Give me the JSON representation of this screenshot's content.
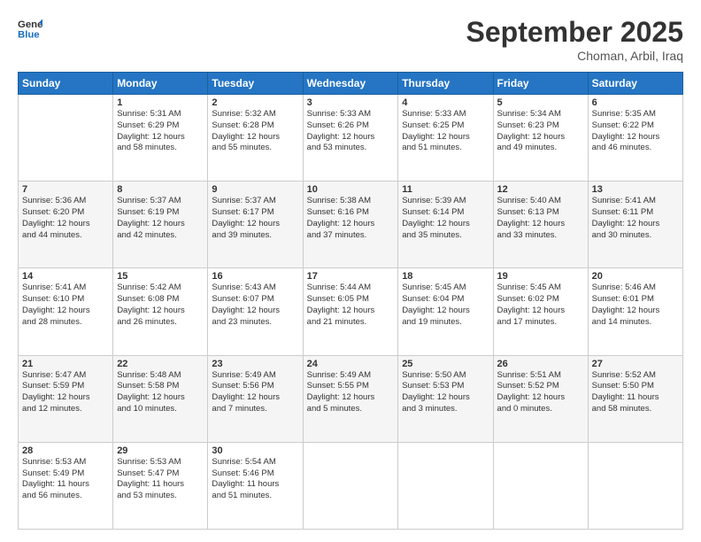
{
  "header": {
    "logo_text_general": "General",
    "logo_text_blue": "Blue",
    "month_title": "September 2025",
    "location": "Choman, Arbil, Iraq"
  },
  "weekdays": [
    "Sunday",
    "Monday",
    "Tuesday",
    "Wednesday",
    "Thursday",
    "Friday",
    "Saturday"
  ],
  "weeks": [
    [
      {
        "day": "",
        "info": ""
      },
      {
        "day": "1",
        "info": "Sunrise: 5:31 AM\nSunset: 6:29 PM\nDaylight: 12 hours\nand 58 minutes."
      },
      {
        "day": "2",
        "info": "Sunrise: 5:32 AM\nSunset: 6:28 PM\nDaylight: 12 hours\nand 55 minutes."
      },
      {
        "day": "3",
        "info": "Sunrise: 5:33 AM\nSunset: 6:26 PM\nDaylight: 12 hours\nand 53 minutes."
      },
      {
        "day": "4",
        "info": "Sunrise: 5:33 AM\nSunset: 6:25 PM\nDaylight: 12 hours\nand 51 minutes."
      },
      {
        "day": "5",
        "info": "Sunrise: 5:34 AM\nSunset: 6:23 PM\nDaylight: 12 hours\nand 49 minutes."
      },
      {
        "day": "6",
        "info": "Sunrise: 5:35 AM\nSunset: 6:22 PM\nDaylight: 12 hours\nand 46 minutes."
      }
    ],
    [
      {
        "day": "7",
        "info": "Sunrise: 5:36 AM\nSunset: 6:20 PM\nDaylight: 12 hours\nand 44 minutes."
      },
      {
        "day": "8",
        "info": "Sunrise: 5:37 AM\nSunset: 6:19 PM\nDaylight: 12 hours\nand 42 minutes."
      },
      {
        "day": "9",
        "info": "Sunrise: 5:37 AM\nSunset: 6:17 PM\nDaylight: 12 hours\nand 39 minutes."
      },
      {
        "day": "10",
        "info": "Sunrise: 5:38 AM\nSunset: 6:16 PM\nDaylight: 12 hours\nand 37 minutes."
      },
      {
        "day": "11",
        "info": "Sunrise: 5:39 AM\nSunset: 6:14 PM\nDaylight: 12 hours\nand 35 minutes."
      },
      {
        "day": "12",
        "info": "Sunrise: 5:40 AM\nSunset: 6:13 PM\nDaylight: 12 hours\nand 33 minutes."
      },
      {
        "day": "13",
        "info": "Sunrise: 5:41 AM\nSunset: 6:11 PM\nDaylight: 12 hours\nand 30 minutes."
      }
    ],
    [
      {
        "day": "14",
        "info": "Sunrise: 5:41 AM\nSunset: 6:10 PM\nDaylight: 12 hours\nand 28 minutes."
      },
      {
        "day": "15",
        "info": "Sunrise: 5:42 AM\nSunset: 6:08 PM\nDaylight: 12 hours\nand 26 minutes."
      },
      {
        "day": "16",
        "info": "Sunrise: 5:43 AM\nSunset: 6:07 PM\nDaylight: 12 hours\nand 23 minutes."
      },
      {
        "day": "17",
        "info": "Sunrise: 5:44 AM\nSunset: 6:05 PM\nDaylight: 12 hours\nand 21 minutes."
      },
      {
        "day": "18",
        "info": "Sunrise: 5:45 AM\nSunset: 6:04 PM\nDaylight: 12 hours\nand 19 minutes."
      },
      {
        "day": "19",
        "info": "Sunrise: 5:45 AM\nSunset: 6:02 PM\nDaylight: 12 hours\nand 17 minutes."
      },
      {
        "day": "20",
        "info": "Sunrise: 5:46 AM\nSunset: 6:01 PM\nDaylight: 12 hours\nand 14 minutes."
      }
    ],
    [
      {
        "day": "21",
        "info": "Sunrise: 5:47 AM\nSunset: 5:59 PM\nDaylight: 12 hours\nand 12 minutes."
      },
      {
        "day": "22",
        "info": "Sunrise: 5:48 AM\nSunset: 5:58 PM\nDaylight: 12 hours\nand 10 minutes."
      },
      {
        "day": "23",
        "info": "Sunrise: 5:49 AM\nSunset: 5:56 PM\nDaylight: 12 hours\nand 7 minutes."
      },
      {
        "day": "24",
        "info": "Sunrise: 5:49 AM\nSunset: 5:55 PM\nDaylight: 12 hours\nand 5 minutes."
      },
      {
        "day": "25",
        "info": "Sunrise: 5:50 AM\nSunset: 5:53 PM\nDaylight: 12 hours\nand 3 minutes."
      },
      {
        "day": "26",
        "info": "Sunrise: 5:51 AM\nSunset: 5:52 PM\nDaylight: 12 hours\nand 0 minutes."
      },
      {
        "day": "27",
        "info": "Sunrise: 5:52 AM\nSunset: 5:50 PM\nDaylight: 11 hours\nand 58 minutes."
      }
    ],
    [
      {
        "day": "28",
        "info": "Sunrise: 5:53 AM\nSunset: 5:49 PM\nDaylight: 11 hours\nand 56 minutes."
      },
      {
        "day": "29",
        "info": "Sunrise: 5:53 AM\nSunset: 5:47 PM\nDaylight: 11 hours\nand 53 minutes."
      },
      {
        "day": "30",
        "info": "Sunrise: 5:54 AM\nSunset: 5:46 PM\nDaylight: 11 hours\nand 51 minutes."
      },
      {
        "day": "",
        "info": ""
      },
      {
        "day": "",
        "info": ""
      },
      {
        "day": "",
        "info": ""
      },
      {
        "day": "",
        "info": ""
      }
    ]
  ]
}
